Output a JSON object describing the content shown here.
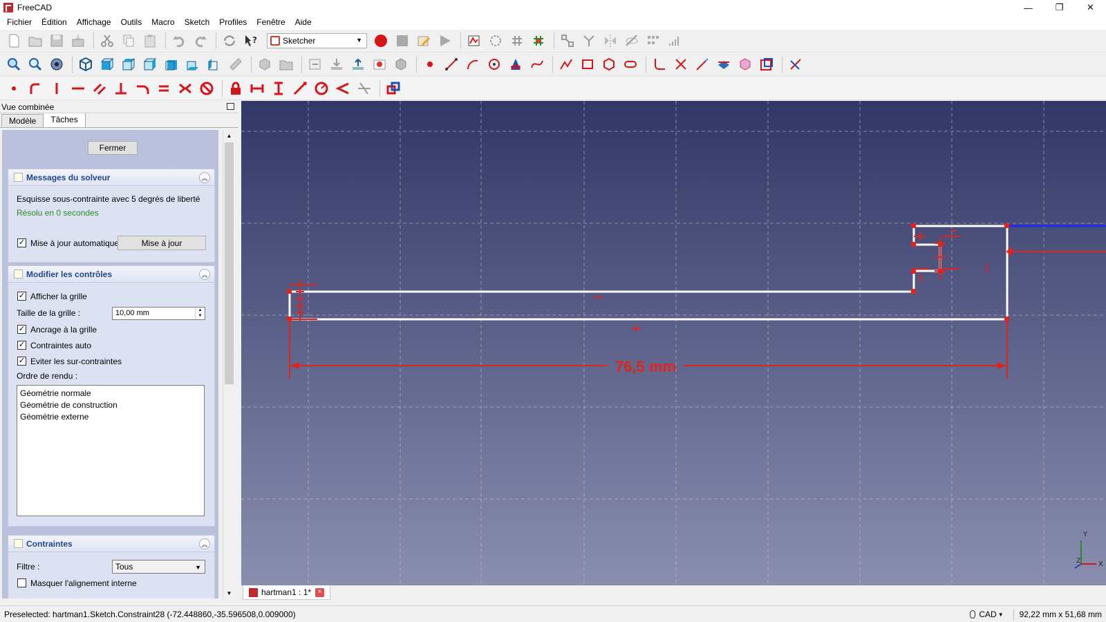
{
  "window": {
    "title": "FreeCAD",
    "controls": [
      "—",
      "❐",
      "✕"
    ]
  },
  "menu": [
    "Fichier",
    "Édition",
    "Affichage",
    "Outils",
    "Macro",
    "Sketch",
    "Profiles",
    "Fenêtre",
    "Aide"
  ],
  "toolbar": {
    "workbench": "Sketcher"
  },
  "combo_view": {
    "title": "Vue combinée",
    "tabs": [
      "Modèle",
      "Tâches"
    ],
    "close_label": "Fermer",
    "solver": {
      "title": "Messages du solveur",
      "message": "Esquisse sous-contrainte avec 5 degrés de liberté",
      "solved": "Résolu en 0 secondes",
      "auto_update_label": "Mise à jour automatique",
      "update_button": "Mise à jour"
    },
    "edit_controls": {
      "title": "Modifier les contrôles",
      "show_grid": "Afficher la grille",
      "grid_size_label": "Taille de la grille :",
      "grid_size_value": "10,00 mm",
      "snap_grid": "Ancrage à la grille",
      "auto_constraints": "Contraintes auto",
      "avoid_redundant": "Eviter les sur-contraintes",
      "render_order_label": "Ordre de rendu :",
      "render_order": [
        "Géométrie normale",
        "Géométrie de construction",
        "Géométrie externe"
      ]
    },
    "constraints": {
      "title": "Contraintes",
      "filter_label": "Filtre :",
      "filter_value": "Tous",
      "hide_internal": "Masquer l'alignement interne"
    }
  },
  "view": {
    "dimension_label": "76,5 mm",
    "axis_y": "Y",
    "axis_x": "X",
    "axis_z": "Z"
  },
  "doc_tab": {
    "label": "hartman1 : 1*"
  },
  "status": {
    "message": "Preselected: hartman1.Sketch.Constraint28 (-72.448860,-35.596508,0.009000)",
    "nav_style": "CAD",
    "dimensions": "92,22 mm x 51,68 mm"
  },
  "colors": {
    "sketch_line": "#ffffff",
    "constraint": "#e0241b",
    "axis_blue": "#1d2cf0",
    "view_top": "#313766",
    "view_bottom": "#8a8eaf"
  }
}
